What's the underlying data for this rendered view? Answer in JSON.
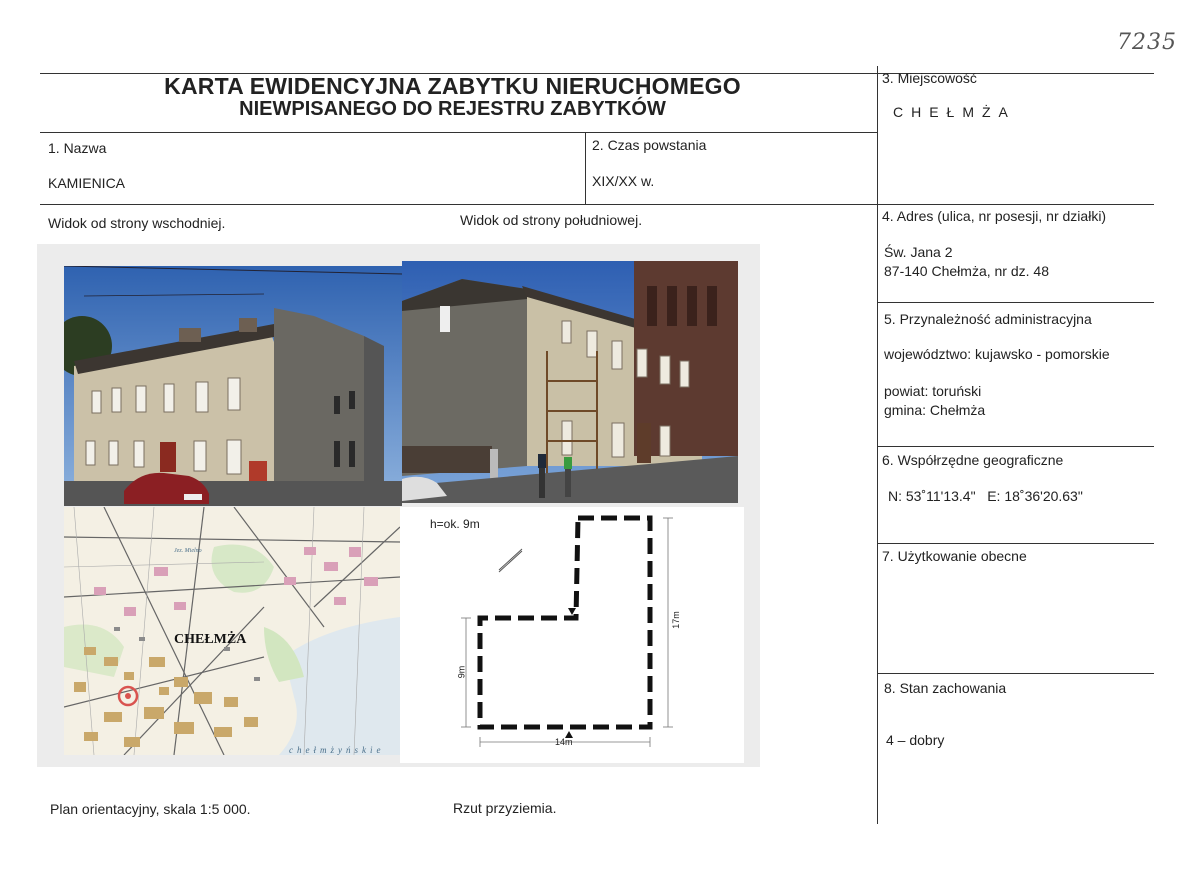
{
  "handwritten_number": "7235",
  "title": {
    "line1": "KARTA EWIDENCYJNA ZABYTKU NIERUCHOMEGO",
    "line2": "NIEWPISANEGO DO REJESTRU ZABYTKÓW"
  },
  "fields": {
    "nazwa": {
      "label": "1. Nazwa",
      "value": "KAMIENICA"
    },
    "czas": {
      "label": "2. Czas powstania",
      "value": "XIX/XX w."
    },
    "miejscowosc": {
      "label": "3. Miejscowość",
      "value": "CHEŁMŻA"
    },
    "adres": {
      "label": "4. Adres (ulica, nr posesji, nr działki)",
      "line1": "Św. Jana 2",
      "line2": "87-140 Chełmża, nr dz. 48"
    },
    "przynaleznosc": {
      "label": "5. Przynależność administracyjna",
      "wojewodztwo": "województwo: kujawsko - pomorskie",
      "powiat": "powiat: toruński",
      "gmina": "gmina: Chełmża"
    },
    "wspolrzedne": {
      "label": "6. Współrzędne geograficzne",
      "value": "N: 53˚11'13.4\"   E: 18˚36'20.63\""
    },
    "uzytkowanie": {
      "label": "7. Użytkowanie obecne",
      "value": ""
    },
    "stan": {
      "label": "8. Stan zachowania",
      "value": "4 – dobry"
    }
  },
  "captions": {
    "widok_wsch": "Widok od strony wschodniej.",
    "widok_pld": "Widok od strony południowej.",
    "plan": "Plan orientacyjny, skala 1:5 000.",
    "rzut": "Rzut przyziemia."
  },
  "floorplan": {
    "height_note": "h=ok. 9m",
    "dim_width": "14m",
    "dim_left": "9m",
    "dim_right": "17m"
  },
  "map": {
    "town_label": "CHEŁMŻA",
    "lake_label": "chełmżyńskie",
    "pond_label": "Jez. Mielno"
  },
  "colors": {
    "sky": "#3a6fb8",
    "facade": "#cfc5ae",
    "grey_wall": "#6b6962",
    "roof": "#3a3530",
    "tower_brick": "#5e3a30",
    "map_red": "#d9534f"
  }
}
